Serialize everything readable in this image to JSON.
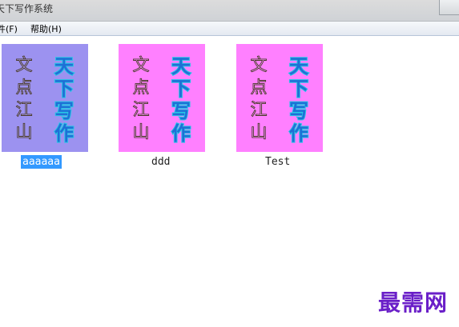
{
  "window": {
    "title": "天下写作系统",
    "titlebar_color": "#d3d6da"
  },
  "menubar": {
    "items": [
      {
        "label": "件(F)"
      },
      {
        "label": "帮助(H)"
      }
    ]
  },
  "items": [
    {
      "name": "aaaaaa",
      "selected": true,
      "bg": "#9c92f0",
      "left_text": [
        "文",
        "点",
        "江",
        "山"
      ],
      "right_text": [
        "天",
        "下",
        "写",
        "作"
      ]
    },
    {
      "name": "ddd",
      "selected": false,
      "bg": "#ff80ff",
      "left_text": [
        "文",
        "点",
        "江",
        "山"
      ],
      "right_text": [
        "天",
        "下",
        "写",
        "作"
      ]
    },
    {
      "name": "Test",
      "selected": false,
      "bg": "#ff80ff",
      "left_text": [
        "文",
        "点",
        "江",
        "山"
      ],
      "right_text": [
        "天",
        "下",
        "写",
        "作"
      ]
    }
  ],
  "colors": {
    "selection": "#3399ff",
    "title_text_fill": "#1f6fd6",
    "title_text_glow": "#27c6e6",
    "body_text_stroke": "#4a3a2a"
  },
  "watermark": {
    "text": "最需网",
    "color": "#6a1fc8"
  }
}
